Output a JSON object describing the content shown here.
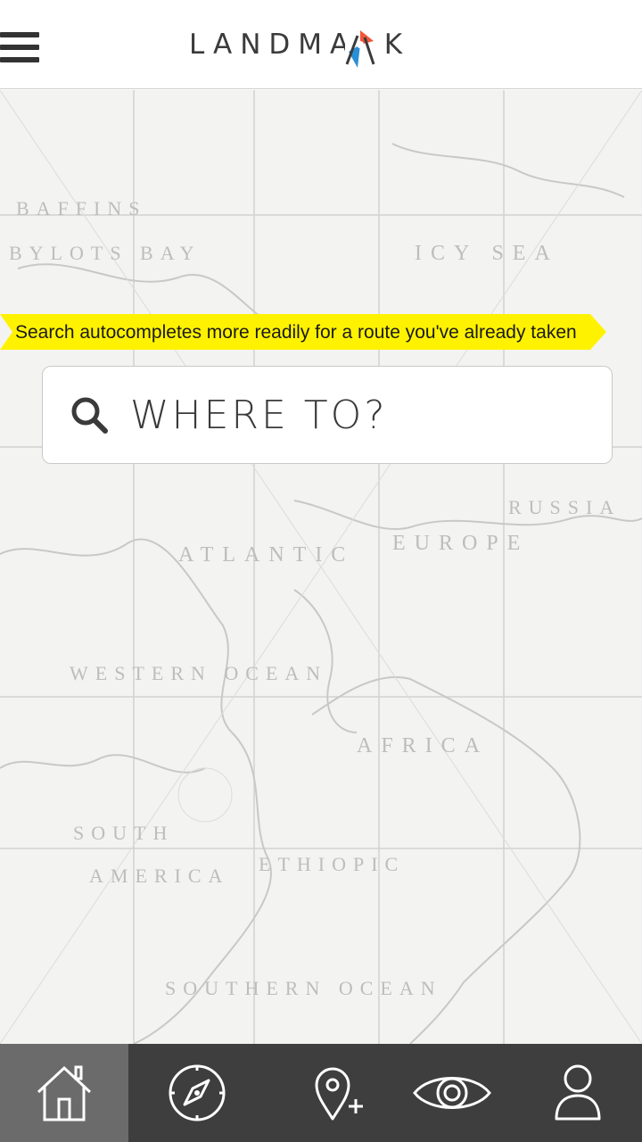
{
  "header": {
    "logo_text": "LANDMARK",
    "menu_icon": "hamburger-menu-icon",
    "accent_colors": {
      "pin_orange": "#f2553b",
      "pin_blue": "#2b8fd6"
    }
  },
  "map": {
    "labels": [
      {
        "id": "baffins",
        "text": "BAFFINS"
      },
      {
        "id": "bylots-bay",
        "text": "BYLOTS BAY"
      },
      {
        "id": "icy-sea",
        "text": "ICY SEA"
      },
      {
        "id": "atlantic",
        "text": "ATLANTIC"
      },
      {
        "id": "europe",
        "text": "EUROPE"
      },
      {
        "id": "russia",
        "text": "RUSSIA"
      },
      {
        "id": "western-ocean",
        "text": "WESTERN OCEAN"
      },
      {
        "id": "africa",
        "text": "AFRICA"
      },
      {
        "id": "south-america-1",
        "text": "SOUTH"
      },
      {
        "id": "south-america-2",
        "text": "AMERICA"
      },
      {
        "id": "ethiopic",
        "text": "ETHIOPIC"
      },
      {
        "id": "southern-ocean",
        "text": "SOUTHERN OCEAN"
      }
    ]
  },
  "banner": {
    "text": "Search autocompletes more readily for a route you've already taken",
    "color": "#fff200"
  },
  "search": {
    "placeholder": "WHERE TO?",
    "icon": "search-icon"
  },
  "bottom_nav": {
    "items": [
      {
        "name": "home",
        "icon": "home-icon",
        "active": true
      },
      {
        "name": "explore",
        "icon": "compass-icon",
        "active": false
      },
      {
        "name": "add-place",
        "icon": "add-location-icon",
        "active": false
      },
      {
        "name": "view",
        "icon": "eye-icon",
        "active": false
      },
      {
        "name": "profile",
        "icon": "user-icon",
        "active": false
      }
    ],
    "background": "#3e3e3e",
    "active_background": "#6b6b6b"
  }
}
